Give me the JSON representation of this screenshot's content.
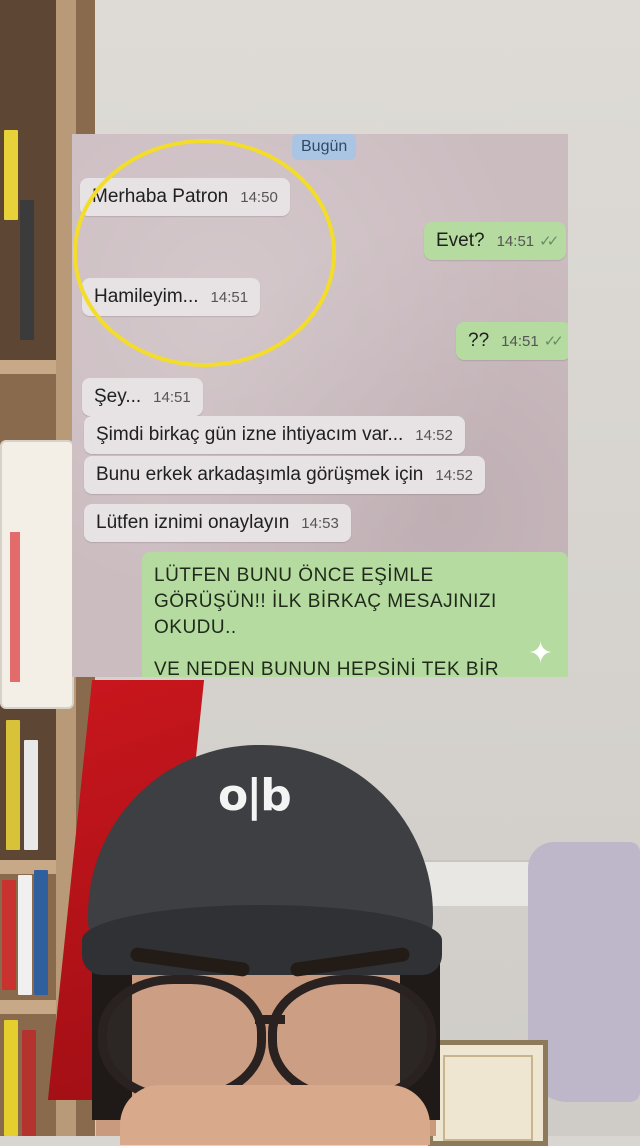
{
  "chat": {
    "date_label": "Bugün",
    "messages": [
      {
        "direction": "in",
        "text": "Merhaba Patron",
        "time": "14:50"
      },
      {
        "direction": "out",
        "text": "Evet?",
        "time": "14:51",
        "ticks": "✓✓"
      },
      {
        "direction": "in",
        "text": "Hamileyim...",
        "time": "14:51"
      },
      {
        "direction": "out",
        "text": "??",
        "time": "14:51",
        "ticks": "✓✓"
      },
      {
        "direction": "in",
        "text": "Şey...",
        "time": "14:51"
      },
      {
        "direction": "in",
        "text": "Şimdi birkaç gün izne ihtiyacım var...",
        "time": "14:52"
      },
      {
        "direction": "in",
        "text": "Bunu erkek arkadaşımla görüşmek için",
        "time": "14:52"
      },
      {
        "direction": "in",
        "text": "Lütfen iznimi onaylayın",
        "time": "14:53"
      }
    ],
    "reply": {
      "line1": "LÜTFEN BUNU ÖNCE EŞİMLE",
      "line2": "GÖRÜŞÜN!! İLK BİRKAÇ MESAJINIZI",
      "line3": "OKUDU..",
      "line4": "VE NEDEN BUNUN HEPSİNİ TEK BİR"
    },
    "highlight_color": "#f3dd2a"
  },
  "scene": {
    "cap_logo": "o|b"
  },
  "icons": {
    "sparkle": "✦"
  }
}
